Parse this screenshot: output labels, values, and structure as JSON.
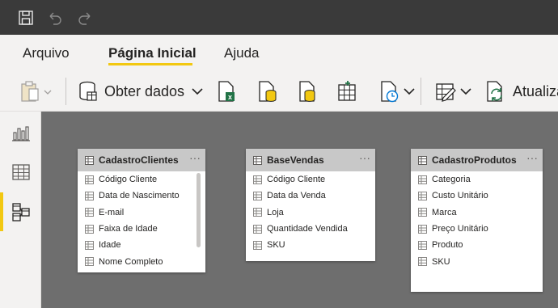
{
  "ribbon": {
    "tabs": [
      {
        "label": "Arquivo"
      },
      {
        "label": "Página Inicial"
      },
      {
        "label": "Ajuda"
      }
    ]
  },
  "toolbar": {
    "get_data_label": "Obter dados",
    "refresh_label": "Atualizar"
  },
  "tables": [
    {
      "name": "CadastroClientes",
      "fields": [
        "Código Cliente",
        "Data de Nascimento",
        "E-mail",
        "Faixa de Idade",
        "Idade",
        "Nome Completo"
      ]
    },
    {
      "name": "BaseVendas",
      "fields": [
        "Código Cliente",
        "Data da Venda",
        "Loja",
        "Quantidade Vendida",
        "SKU"
      ]
    },
    {
      "name": "CadastroProdutos",
      "fields": [
        "Categoria",
        "Custo Unitário",
        "Marca",
        "Preço Unitário",
        "Produto",
        "SKU"
      ]
    }
  ],
  "more_glyph": "···",
  "colors": {
    "accent": "#f2c811",
    "titlebar": "#3a3a3a",
    "canvas": "#6e6e6e",
    "card_header": "#c8c8c8"
  }
}
